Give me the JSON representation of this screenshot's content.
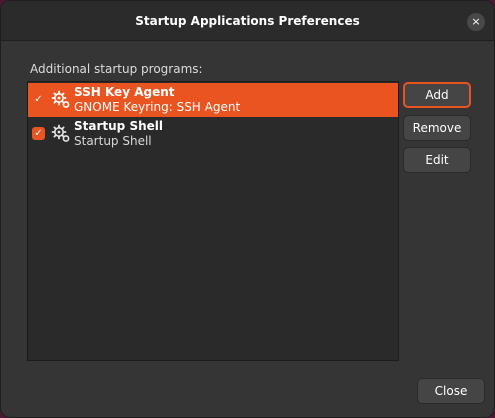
{
  "window": {
    "title": "Startup Applications Preferences",
    "close_glyph": "×"
  },
  "section": {
    "label": "Additional startup programs:"
  },
  "programs": [
    {
      "name": "SSH Key Agent",
      "description": "GNOME Keyring: SSH Agent",
      "enabled": true,
      "selected": true,
      "icon": "gears-icon"
    },
    {
      "name": "Startup Shell",
      "description": "Startup Shell",
      "enabled": true,
      "selected": false,
      "icon": "gears-icon"
    }
  ],
  "buttons": {
    "add": "Add",
    "remove": "Remove",
    "edit": "Edit",
    "close": "Close"
  },
  "colors": {
    "accent": "#e95420",
    "dialog_bg": "#353535",
    "list_bg": "#2a2a2a"
  }
}
